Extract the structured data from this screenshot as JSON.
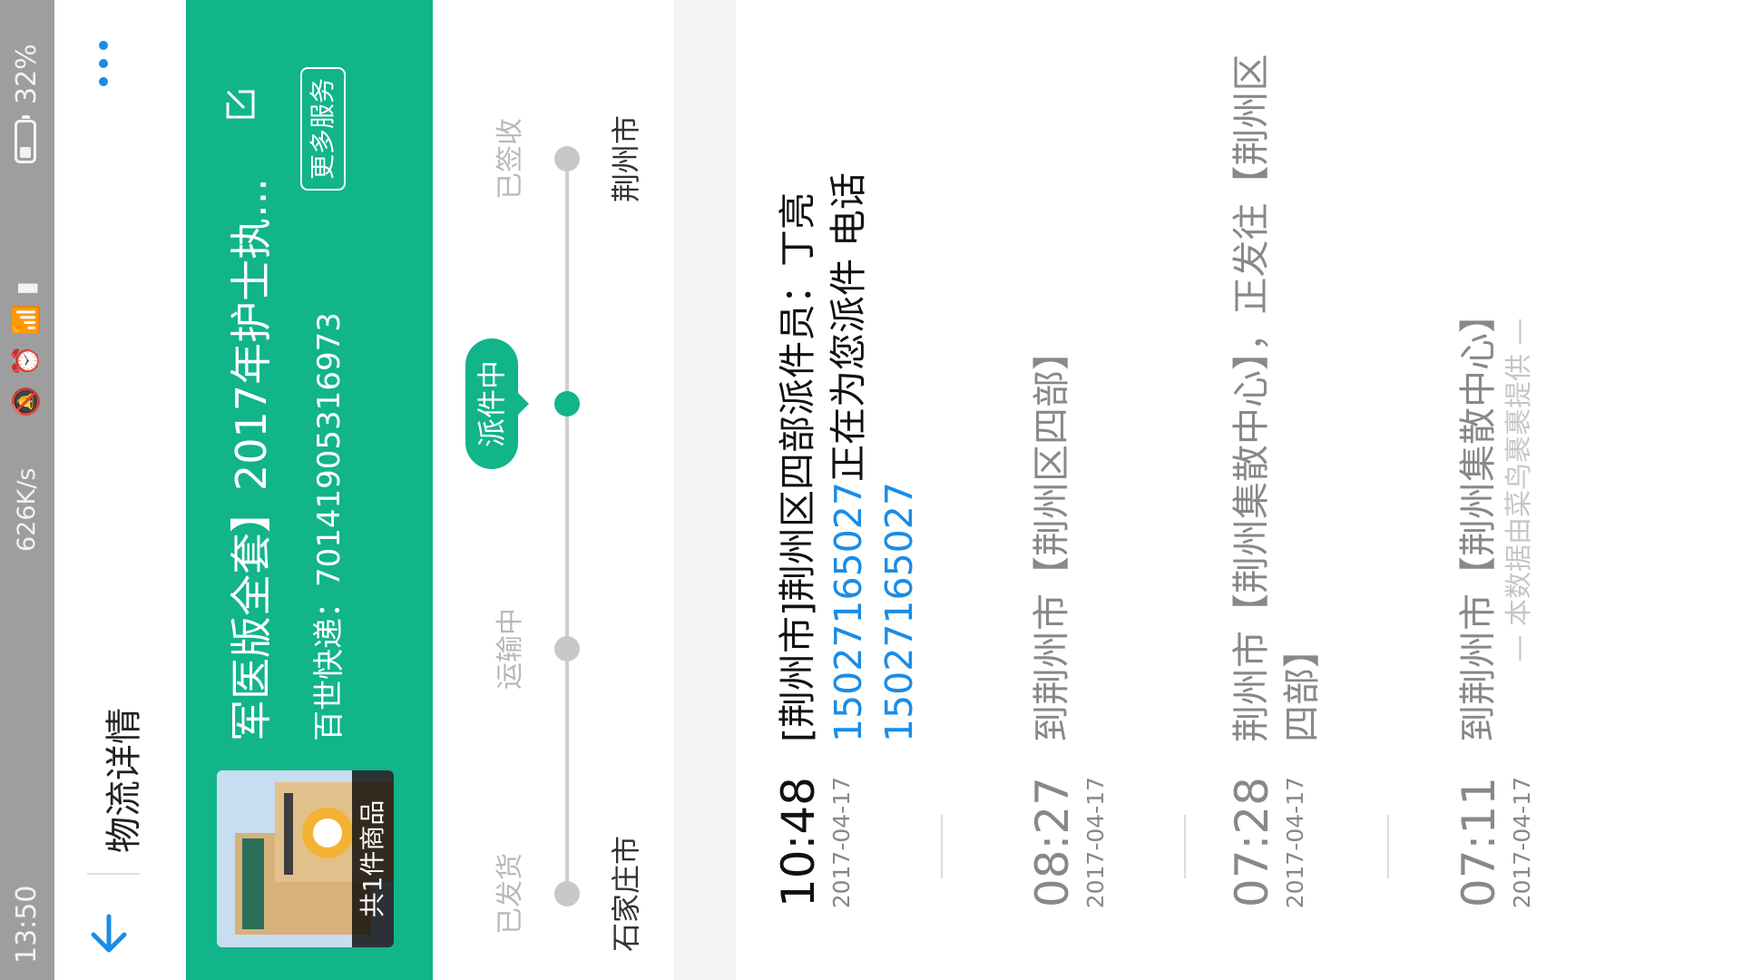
{
  "status_bar": {
    "time": "13:50",
    "speed": "626K/s",
    "battery": "32%",
    "battery_level": 0.32,
    "icons": [
      "mute-icon",
      "alarm-icon",
      "wifi-icon",
      "signal-icon",
      "battery-icon"
    ]
  },
  "header": {
    "title": "物流详情",
    "back_icon": "arrow-back-icon",
    "more_icon": "more-dots-icon"
  },
  "package": {
    "name": "军医版全套】2017年护士执...",
    "courier_label": "百世快递：70141905316973",
    "count_label": "共1件商品",
    "more_services": "更多服务",
    "edit_icon": "edit-icon"
  },
  "progress": {
    "steps": [
      "已发货",
      "运输中",
      "派件中",
      "已签收"
    ],
    "current_step": 2,
    "origin_city": "石家庄市",
    "destination_city": "荆州市"
  },
  "timeline": [
    {
      "time": "10:48",
      "date": "2017-04-17",
      "text_parts": [
        {
          "t": "[荆州市]荆州区四部派件员：丁亮"
        },
        {
          "t": "15027165027",
          "link": true
        },
        {
          "t": "正在为您派件 电话"
        },
        {
          "t": "15027165027",
          "link": true
        }
      ]
    },
    {
      "time": "08:27",
      "date": "2017-04-17",
      "text_parts": [
        {
          "t": "到荆州市【荆州区四部】"
        }
      ]
    },
    {
      "time": "07:28",
      "date": "2017-04-17",
      "text_parts": [
        {
          "t": "荆州市【荆州集散中心】，正发往【荆州区四部】"
        }
      ]
    },
    {
      "time": "07:11",
      "date": "2017-04-17",
      "text_parts": [
        {
          "t": "到荆州市【荆州集散中心】"
        }
      ]
    }
  ],
  "footer": "— 本数据由菜鸟裹裹提供 —",
  "colors": {
    "brand": "#12b48a",
    "link": "#1a8ce6",
    "status_bar": "#9e9e9e",
    "inactive": "#c8c8c8"
  }
}
